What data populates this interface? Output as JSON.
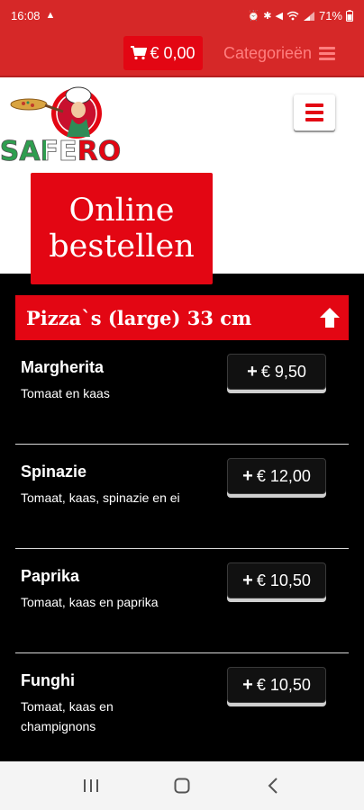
{
  "status_bar": {
    "time": "16:08",
    "battery": "71%"
  },
  "topbar": {
    "cart_total": "€ 0,00",
    "categories_label": "Categorieën"
  },
  "header": {
    "logo_text": "SAFERO",
    "order_title_line1": "Online",
    "order_title_line2": "bestellen"
  },
  "category": {
    "title": "Pizza`s (large) 33 cm"
  },
  "items": [
    {
      "name": "Margherita",
      "description": "Tomaat en kaas",
      "price": "€ 9,50"
    },
    {
      "name": "Spinazie",
      "description": "Tomaat, kaas, spinazie en ei",
      "price": "€ 12,00"
    },
    {
      "name": "Paprika",
      "description": "Tomaat, kaas en paprika",
      "price": "€ 10,50"
    },
    {
      "name": "Funghi",
      "description": "Tomaat, kaas en champignons",
      "price": "€ 10,50"
    }
  ],
  "colors": {
    "brand_red": "#e30613",
    "topbar_red": "#d62828",
    "menu_background": "#000000"
  },
  "icons": {
    "cart": "cart-icon",
    "categories": "hamburger-icon",
    "menu": "hamburger-icon",
    "collapse": "arrow-up-icon",
    "add": "plus-icon"
  }
}
